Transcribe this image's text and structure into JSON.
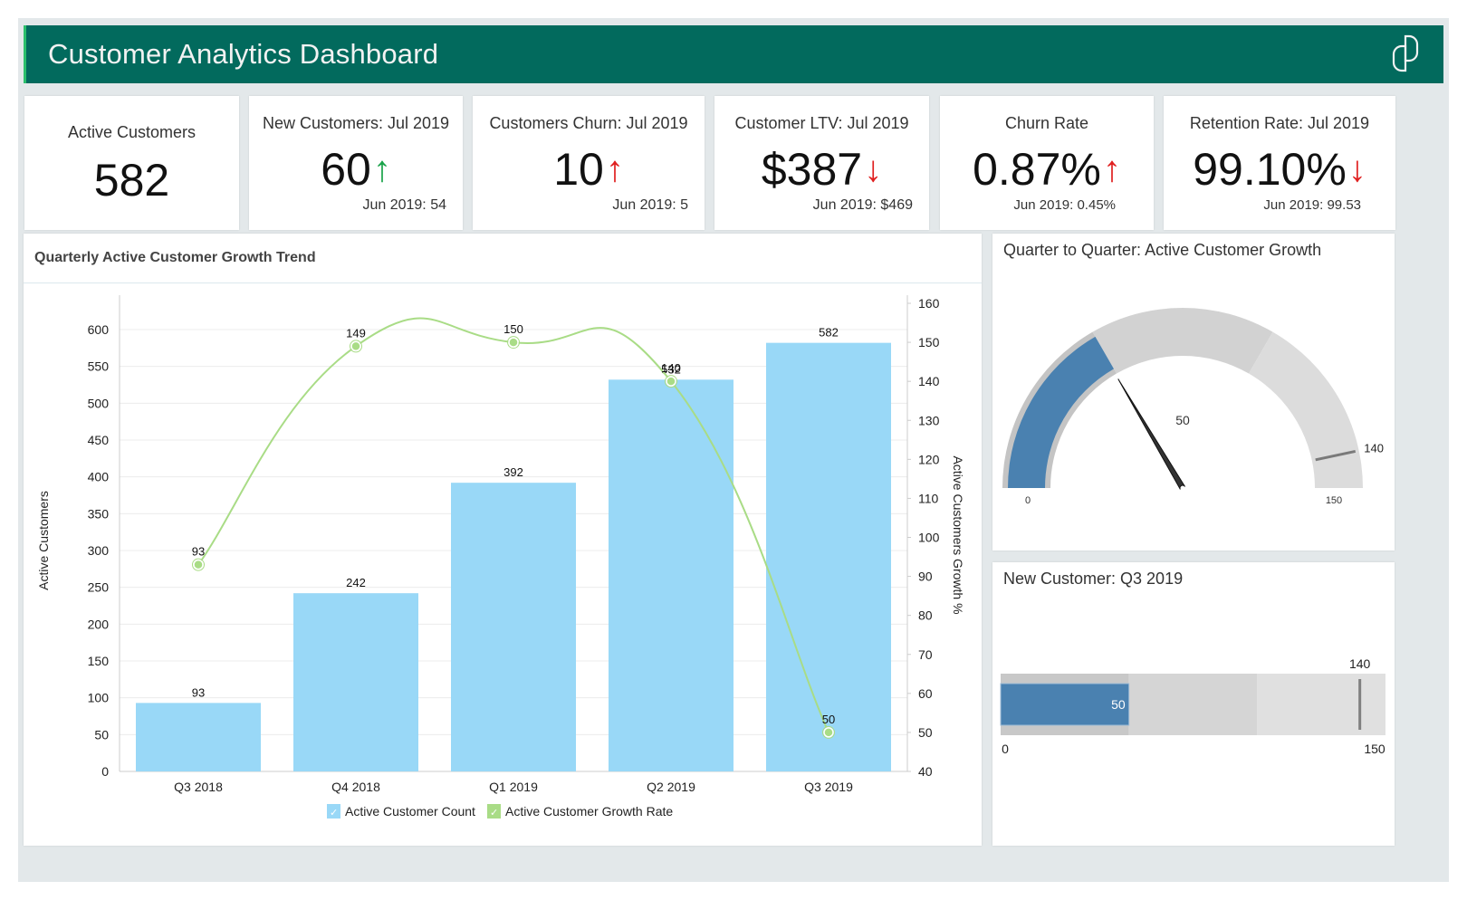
{
  "header": {
    "title": "Customer Analytics Dashboard",
    "logo_icon": "brand-logo-icon"
  },
  "kpis": [
    {
      "title": "Active Customers",
      "value": "582",
      "arrow": "",
      "trend": "none",
      "previous": ""
    },
    {
      "title": "New Customers: Jul 2019",
      "value": "60",
      "arrow": "↑",
      "trend": "up-good",
      "previous": "Jun 2019: 54"
    },
    {
      "title": "Customers Churn: Jul 2019",
      "value": "10",
      "arrow": "↑",
      "trend": "up-bad",
      "previous": "Jun 2019: 5"
    },
    {
      "title": "Customer LTV: Jul 2019",
      "value": "$387",
      "arrow": "↓",
      "trend": "down-bad",
      "previous": "Jun 2019: $469"
    },
    {
      "title": "Churn Rate",
      "value": "0.87%",
      "arrow": "↑",
      "trend": "up-bad",
      "previous": "Jun 2019: 0.45%"
    },
    {
      "title": "Retention Rate: Jul 2019",
      "value": "99.10%",
      "arrow": "↓",
      "trend": "down-bad",
      "previous": "Jun 2019: 99.53"
    }
  ],
  "colors": {
    "header_bg": "#026a5d",
    "bar": "#99d8f7",
    "line": "#a9dc86",
    "gauge_fill": "#4a81b0",
    "gauge_track": "#d9d9d9",
    "up_good": "#1aa34a",
    "bad": "#e02020"
  },
  "trend_panel": {
    "title": "Quarterly Active Customer Growth Trend"
  },
  "gauge_panel": {
    "title": "Quarter to Quarter: Active Customer Growth",
    "value": 50,
    "value_label": "50",
    "min": 0,
    "max": 150,
    "min_label": "0",
    "max_label": "150",
    "target": 140,
    "target_label": "140",
    "bands": [
      50,
      100,
      150
    ]
  },
  "bullet_panel": {
    "title": "New Customer: Q3 2019",
    "value": 50,
    "value_label": "50",
    "min": 0,
    "max": 150,
    "min_label": "0",
    "max_label": "150",
    "target": 140,
    "target_label": "140",
    "bands": [
      50,
      100,
      150
    ]
  },
  "chart_data": {
    "type": "bar",
    "title": "Quarterly Active Customer Growth Trend",
    "categories": [
      "Q3 2018",
      "Q4 2018",
      "Q1 2019",
      "Q2 2019",
      "Q3 2019"
    ],
    "series": [
      {
        "name": "Active Customer Count",
        "type": "bar",
        "axis": "left",
        "values": [
          93,
          242,
          392,
          532,
          582
        ]
      },
      {
        "name": "Active Customer Growth Rate",
        "type": "line",
        "axis": "right",
        "values": [
          93,
          149,
          150,
          140,
          50
        ]
      }
    ],
    "ylabel": "Active Customers",
    "ylim": [
      0,
      600
    ],
    "yticks": [
      0,
      50,
      100,
      150,
      200,
      250,
      300,
      350,
      400,
      450,
      500,
      550,
      600
    ],
    "y2label": "Active Customers Growth %",
    "y2lim": [
      40,
      160
    ],
    "y2ticks": [
      40,
      50,
      60,
      70,
      80,
      90,
      100,
      110,
      120,
      130,
      140,
      150,
      160
    ],
    "grid": true,
    "legend": "bottom-center"
  }
}
